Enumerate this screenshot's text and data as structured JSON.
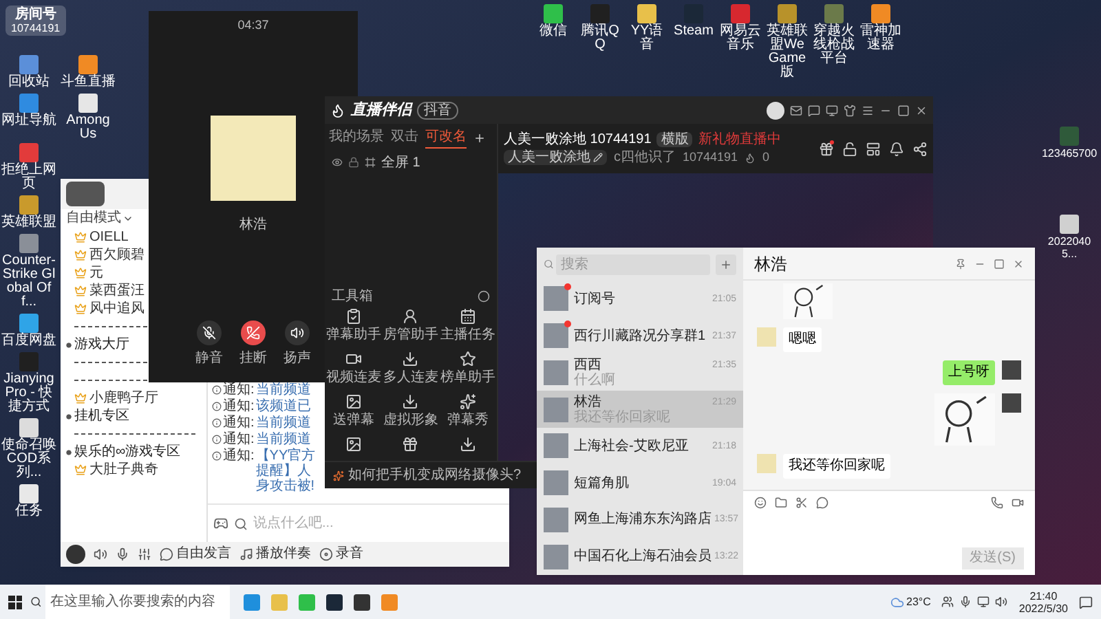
{
  "overlay": {
    "label": "房间号",
    "room": "10744191"
  },
  "desktop_icons": [
    {
      "label": "回收站"
    },
    {
      "label": "斗鱼直播"
    },
    {
      "label": "网址导航"
    },
    {
      "label": "Among Us"
    },
    {
      "label": "拒绝上网页"
    },
    {
      "label": "英雄联盟"
    },
    {
      "label": "Counter-Strike Global Off..."
    },
    {
      "label": "百度网盘"
    },
    {
      "label": "JianyingPro - 快捷方式"
    },
    {
      "label": "使命召唤COD系列..."
    },
    {
      "label": "任务"
    }
  ],
  "top_icons": [
    {
      "label": "微信"
    },
    {
      "label": "腾讯QQ"
    },
    {
      "label": "YY语音"
    },
    {
      "label": "Steam"
    },
    {
      "label": "网易云音乐"
    },
    {
      "label": "英雄联盟WeGame版"
    },
    {
      "label": "穿越火线枪战平台"
    },
    {
      "label": "雷神加速器"
    }
  ],
  "right_icons": [
    {
      "label": "123465700"
    },
    {
      "label": "20220405..."
    }
  ],
  "yy": {
    "mode": "自由模式",
    "tree": [
      {
        "kind": "member",
        "name": "OIELL"
      },
      {
        "kind": "member",
        "name": "西欠顾碧"
      },
      {
        "kind": "member",
        "name": "元"
      },
      {
        "kind": "member",
        "name": "菜西蛋汪"
      },
      {
        "kind": "member",
        "name": "风中追风"
      },
      {
        "kind": "divider"
      },
      {
        "kind": "channel",
        "name": "游戏大厅"
      },
      {
        "kind": "divider"
      },
      {
        "kind": "divider"
      },
      {
        "kind": "member",
        "name": "小鹿鸭子厅"
      },
      {
        "kind": "channel",
        "name": "挂机专区"
      },
      {
        "kind": "divider"
      },
      {
        "kind": "channel",
        "name": "娱乐的∞游戏专区"
      },
      {
        "kind": "member",
        "name": "大肚子典奇"
      }
    ],
    "notices": [
      {
        "label": "通知:",
        "text": "当前频道"
      },
      {
        "label": "通知:",
        "text": "该频道已"
      },
      {
        "label": "通知:",
        "text": "当前频道"
      },
      {
        "label": "通知:",
        "text": "当前频道"
      },
      {
        "label": "通知:",
        "text": "【YY官方提醒】人身攻击被!"
      }
    ],
    "input": {
      "placeholder": "说点什么吧..."
    },
    "toolbar": [
      {
        "kind": "speak",
        "label": "自由发言"
      },
      {
        "kind": "music",
        "label": "播放伴奏"
      },
      {
        "kind": "record",
        "label": "录音"
      }
    ]
  },
  "call": {
    "time": "04:37",
    "name": "林浩",
    "buttons": [
      {
        "kind": "mute",
        "label": "静音"
      },
      {
        "kind": "hangup",
        "label": "挂断"
      },
      {
        "kind": "speaker",
        "label": "扬声"
      }
    ]
  },
  "studio": {
    "title": "直播伴侣",
    "badge": "抖音",
    "tabs": [
      {
        "label": "我的场景",
        "selected": false
      },
      {
        "label": "双击",
        "selected": false
      },
      {
        "label": "可改名",
        "selected": true
      }
    ],
    "scene": "全屏 1",
    "toolbox": "工具箱",
    "tools": [
      {
        "label": "弹幕助手"
      },
      {
        "label": "房管助手"
      },
      {
        "label": "主播任务"
      },
      {
        "label": "视频连麦"
      },
      {
        "label": "多人连麦"
      },
      {
        "label": "榜单助手"
      },
      {
        "label": "送弹幕"
      },
      {
        "label": "虚拟形象"
      },
      {
        "label": "弹幕秀"
      }
    ],
    "stream_title": "人美一败涂地 10744191",
    "orientation": "横版",
    "status": "新礼物直播中",
    "nickname": "人美一败涂地",
    "followed": "c四他识了",
    "id": "10744191",
    "heat": "0",
    "tip": "如何把手机变成网络摄像头?"
  },
  "wechat": {
    "search": {
      "placeholder": "搜索"
    },
    "chats": [
      {
        "name": "订阅号",
        "time": "21:05",
        "unread": true,
        "selected": false
      },
      {
        "name": "西行川藏路况分享群1",
        "time": "21:37",
        "unread": true,
        "selected": false
      },
      {
        "name": "西西",
        "time": "21:35",
        "preview": "什么啊",
        "unread": false,
        "selected": false
      },
      {
        "name": "林浩",
        "time": "21:29",
        "preview": "我还等你回家呢",
        "unread": false,
        "selected": true
      },
      {
        "name": "上海社会-艾欧尼亚",
        "time": "21:18",
        "unread": false,
        "selected": false
      },
      {
        "name": "短篇角肌",
        "time": "19:04",
        "unread": false,
        "selected": false
      },
      {
        "name": "网鱼上海浦东东沟路店",
        "time": "13:57",
        "unread": false,
        "selected": false
      },
      {
        "name": "中国石化上海石油会员",
        "time": "13:22",
        "unread": false,
        "selected": false
      }
    ],
    "contact": "林浩",
    "messages": [
      {
        "kind": "sticker",
        "from_me": false
      },
      {
        "kind": "text",
        "from_me": false,
        "text": "嗯嗯"
      },
      {
        "kind": "text",
        "from_me": true,
        "text": "上号呀"
      },
      {
        "kind": "sticker",
        "from_me": true
      },
      {
        "kind": "text",
        "from_me": false,
        "text": "我还等你回家呢"
      }
    ],
    "send": "发送(S)"
  },
  "taskbar": {
    "search": {
      "placeholder": "在这里输入你要搜索的内容"
    },
    "weather": "23°C",
    "time": "21:40",
    "date": "2022/5/30"
  }
}
